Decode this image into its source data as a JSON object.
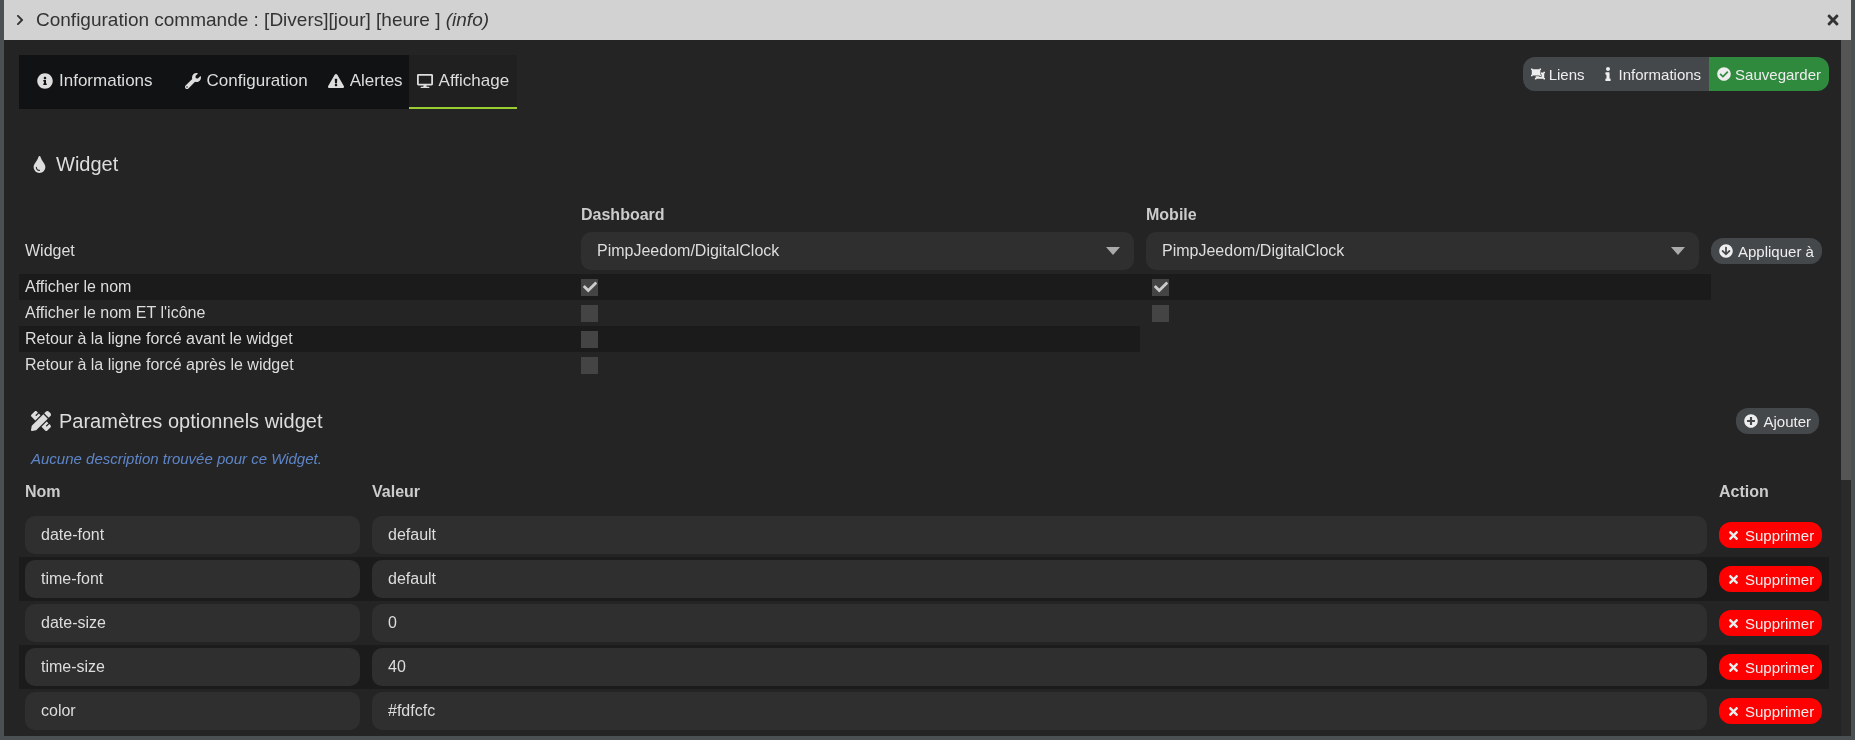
{
  "window": {
    "title": "Configuration commande : [Divers][jour] [heure ]",
    "subtitle": "(info)"
  },
  "tabs": [
    {
      "label": "Informations",
      "selected": false
    },
    {
      "label": "Configuration",
      "selected": false
    },
    {
      "label": "Alertes",
      "selected": false
    },
    {
      "label": "Affichage",
      "selected": true
    }
  ],
  "actions": [
    {
      "label": "Liens",
      "kind": "plain"
    },
    {
      "label": "Informations",
      "kind": "plain"
    },
    {
      "label": "Sauvegarder",
      "kind": "success"
    }
  ],
  "widget": {
    "heading": "Widget",
    "columns": [
      "Dashboard",
      "Mobile"
    ],
    "row_label": "Widget",
    "dashboard_value": "PimpJeedom/DigitalClock",
    "mobile_value": "PimpJeedom/DigitalClock",
    "apply_button": "Appliquer à",
    "options": [
      {
        "label": "Afficher le nom",
        "dashboard_checked": true,
        "mobile_checked": true
      },
      {
        "label": "Afficher le nom ET l'icône",
        "dashboard_checked": false,
        "mobile_checked": false
      },
      {
        "label": "Retour à la ligne forcé avant le widget",
        "dashboard_checked": false
      },
      {
        "label": "Retour à la ligne forcé après le widget",
        "dashboard_checked": false
      }
    ]
  },
  "parameters": {
    "heading": "Paramètres optionnels widget",
    "add_button": "Ajouter",
    "note": "Aucune description trouvée pour ce Widget.",
    "columns": [
      "Nom",
      "Valeur",
      "Action"
    ],
    "rows": [
      {
        "name": "date-font",
        "value": "default",
        "action": "Supprimer"
      },
      {
        "name": "time-font",
        "value": "default",
        "action": "Supprimer"
      },
      {
        "name": "date-size",
        "value": "0",
        "action": "Supprimer"
      },
      {
        "name": "time-size",
        "value": "40",
        "action": "Supprimer"
      },
      {
        "name": "color",
        "value": "#fdfcfc",
        "action": "Supprimer"
      }
    ]
  }
}
